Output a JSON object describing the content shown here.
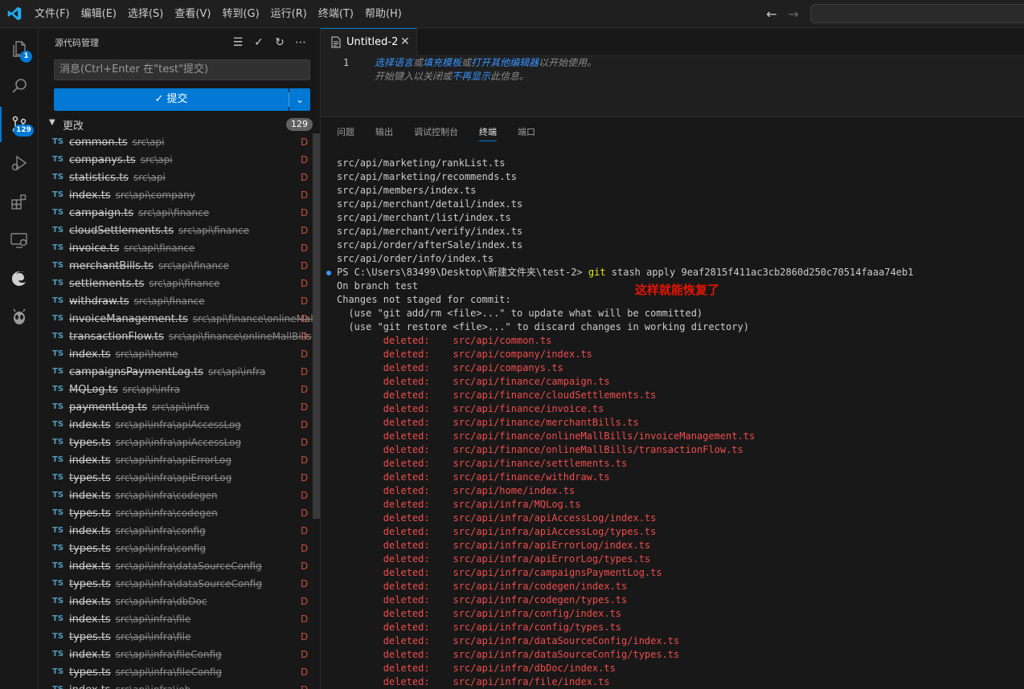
{
  "menubar": [
    "文件(F)",
    "编辑(E)",
    "选择(S)",
    "查看(V)",
    "转到(G)",
    "运行(R)",
    "终端(T)",
    "帮助(H)"
  ],
  "activitybar": {
    "explorer_badge": "1",
    "scm_badge": "129",
    "accent": "#0078d4"
  },
  "sidebar": {
    "title": "源代码管理",
    "commit_placeholder": "消息(Ctrl+Enter 在\"test\"提交)",
    "commit_label": "✓ 提交",
    "changes_label": "更改",
    "changes_count": "129",
    "files": [
      {
        "name": "common.ts",
        "path": "src\\api",
        "status": "D"
      },
      {
        "name": "companys.ts",
        "path": "src\\api",
        "status": "D"
      },
      {
        "name": "statistics.ts",
        "path": "src\\api",
        "status": "D"
      },
      {
        "name": "index.ts",
        "path": "src\\api\\company",
        "status": "D"
      },
      {
        "name": "campaign.ts",
        "path": "src\\api\\finance",
        "status": "D"
      },
      {
        "name": "cloudSettlements.ts",
        "path": "src\\api\\finance",
        "status": "D"
      },
      {
        "name": "invoice.ts",
        "path": "src\\api\\finance",
        "status": "D"
      },
      {
        "name": "merchantBills.ts",
        "path": "src\\api\\finance",
        "status": "D"
      },
      {
        "name": "settlements.ts",
        "path": "src\\api\\finance",
        "status": "D"
      },
      {
        "name": "withdraw.ts",
        "path": "src\\api\\finance",
        "status": "D"
      },
      {
        "name": "invoiceManagement.ts",
        "path": "src\\api\\finance\\onlineMall...",
        "status": "D"
      },
      {
        "name": "transactionFlow.ts",
        "path": "src\\api\\finance\\onlineMallBills",
        "status": "D"
      },
      {
        "name": "index.ts",
        "path": "src\\api\\home",
        "status": "D"
      },
      {
        "name": "campaignsPaymentLog.ts",
        "path": "src\\api\\infra",
        "status": "D"
      },
      {
        "name": "MQLog.ts",
        "path": "src\\api\\infra",
        "status": "D"
      },
      {
        "name": "paymentLog.ts",
        "path": "src\\api\\infra",
        "status": "D"
      },
      {
        "name": "index.ts",
        "path": "src\\api\\infra\\apiAccessLog",
        "status": "D"
      },
      {
        "name": "types.ts",
        "path": "src\\api\\infra\\apiAccessLog",
        "status": "D"
      },
      {
        "name": "index.ts",
        "path": "src\\api\\infra\\apiErrorLog",
        "status": "D"
      },
      {
        "name": "types.ts",
        "path": "src\\api\\infra\\apiErrorLog",
        "status": "D"
      },
      {
        "name": "index.ts",
        "path": "src\\api\\infra\\codegen",
        "status": "D"
      },
      {
        "name": "types.ts",
        "path": "src\\api\\infra\\codegen",
        "status": "D"
      },
      {
        "name": "index.ts",
        "path": "src\\api\\infra\\config",
        "status": "D"
      },
      {
        "name": "types.ts",
        "path": "src\\api\\infra\\config",
        "status": "D"
      },
      {
        "name": "index.ts",
        "path": "src\\api\\infra\\dataSourceConfig",
        "status": "D"
      },
      {
        "name": "types.ts",
        "path": "src\\api\\infra\\dataSourceConfig",
        "status": "D"
      },
      {
        "name": "index.ts",
        "path": "src\\api\\infra\\dbDoc",
        "status": "D"
      },
      {
        "name": "index.ts",
        "path": "src\\api\\infra\\file",
        "status": "D"
      },
      {
        "name": "types.ts",
        "path": "src\\api\\infra\\file",
        "status": "D"
      },
      {
        "name": "index.ts",
        "path": "src\\api\\infra\\fileConfig",
        "status": "D"
      },
      {
        "name": "types.ts",
        "path": "src\\api\\infra\\fileConfig",
        "status": "D"
      },
      {
        "name": "index.ts",
        "path": "src\\api\\infra\\job",
        "status": "D"
      }
    ]
  },
  "editor": {
    "tab_label": "Untitled-2",
    "line_number": "1",
    "hint_link_1": "选择语言",
    "hint_or": "或",
    "hint_link_2": "填充模板",
    "hint_or2": "或",
    "hint_link_3": "打开其他编辑器",
    "hint_tail_1": "以开始使用。",
    "hint_2a": "开始键入以关闭或",
    "hint_link_4": "不再显示",
    "hint_2b": "此信息。"
  },
  "panel": {
    "tabs": [
      "问题",
      "输出",
      "调试控制台",
      "终端",
      "端口"
    ],
    "active_tab": "终端",
    "annotation": "这样就能恢复了",
    "prompt": "PS C:\\Users\\83499\\Desktop\\新建文件夹\\test-2> ",
    "command": "git",
    "command_args": " stash apply 9eaf2815f411ac3cb2860d250c70514faaa74eb1",
    "pre_lines": [
      "src/api/marketing/rankList.ts",
      "src/api/marketing/recommends.ts",
      "src/api/members/index.ts",
      "src/api/merchant/detail/index.ts",
      "src/api/merchant/list/index.ts",
      "src/api/merchant/verify/index.ts",
      "src/api/order/afterSale/index.ts",
      "src/api/order/info/index.ts"
    ],
    "post_lines": [
      "On branch test",
      "Changes not staged for commit:",
      "  (use \"git add/rm <file>...\" to update what will be committed)",
      "  (use \"git restore <file>...\" to discard changes in working directory)"
    ],
    "deleted_prefix": "        deleted:    ",
    "deleted_files": [
      "src/api/common.ts",
      "src/api/company/index.ts",
      "src/api/companys.ts",
      "src/api/finance/campaign.ts",
      "src/api/finance/cloudSettlements.ts",
      "src/api/finance/invoice.ts",
      "src/api/finance/merchantBills.ts",
      "src/api/finance/onlineMallBills/invoiceManagement.ts",
      "src/api/finance/onlineMallBills/transactionFlow.ts",
      "src/api/finance/settlements.ts",
      "src/api/finance/withdraw.ts",
      "src/api/home/index.ts",
      "src/api/infra/MQLog.ts",
      "src/api/infra/apiAccessLog/index.ts",
      "src/api/infra/apiAccessLog/types.ts",
      "src/api/infra/apiErrorLog/index.ts",
      "src/api/infra/apiErrorLog/types.ts",
      "src/api/infra/campaignsPaymentLog.ts",
      "src/api/infra/codegen/index.ts",
      "src/api/infra/codegen/types.ts",
      "src/api/infra/config/index.ts",
      "src/api/infra/config/types.ts",
      "src/api/infra/dataSourceConfig/index.ts",
      "src/api/infra/dataSourceConfig/types.ts",
      "src/api/infra/dbDoc/index.ts",
      "src/api/infra/file/index.ts"
    ]
  }
}
